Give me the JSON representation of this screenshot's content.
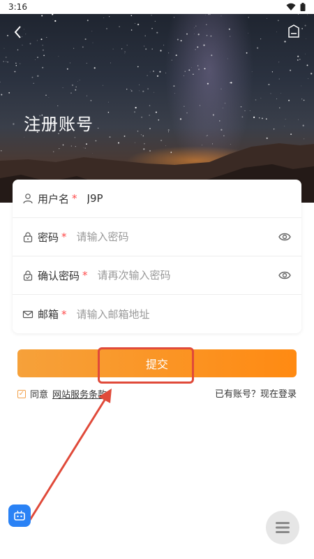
{
  "status_bar": {
    "time": "3:16",
    "icons": [
      "wifi-icon",
      "battery-icon"
    ]
  },
  "header": {
    "title": "注册账号",
    "back_icon": "chevron-left-icon",
    "right_icon": "profile-card-icon"
  },
  "form": {
    "username": {
      "label": "用户名",
      "required_mark": "*",
      "value": "J9P",
      "icon": "user-icon"
    },
    "password": {
      "label": "密码",
      "required_mark": "*",
      "placeholder": "请输入密码",
      "icon": "lock-icon",
      "toggle_icon": "eye-icon"
    },
    "confirm_password": {
      "label": "确认密码",
      "required_mark": "*",
      "placeholder": "请再次输入密码",
      "icon": "lock-check-icon",
      "toggle_icon": "eye-icon"
    },
    "email": {
      "label": "邮箱",
      "required_mark": "*",
      "placeholder": "请输入邮箱地址",
      "icon": "mail-icon"
    }
  },
  "submit_button": {
    "label": "提交"
  },
  "agreement": {
    "prefix": "同意",
    "link": "网站服务条款",
    "checked": true
  },
  "login_link": {
    "label": "已有账号？现在登录"
  },
  "colors": {
    "accent": "#ff8a12",
    "highlight": "#e04a3a",
    "robot": "#2a82f5"
  }
}
